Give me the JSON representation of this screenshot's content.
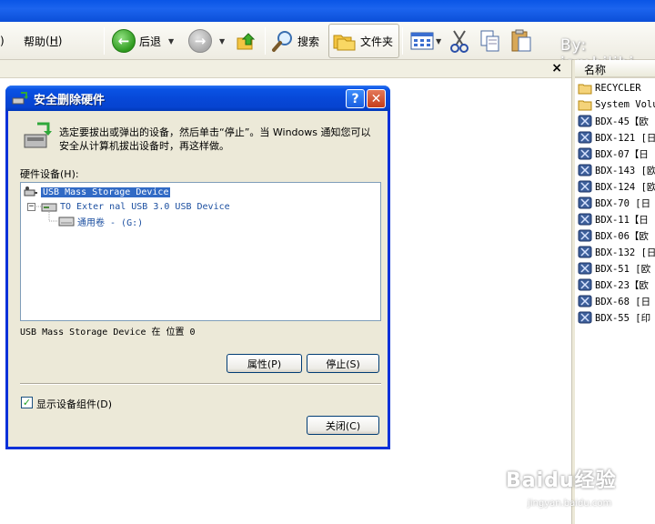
{
  "toolbar": {
    "left_fragment": ")",
    "help_label": "帮助",
    "help_key": "H",
    "back_label": "后退",
    "search_label": "搜索",
    "folders_label": "文件夹",
    "watermark": "By: iambilibi"
  },
  "explorer": {
    "close_glyph": "×",
    "name_column": "名称",
    "files": [
      {
        "name": "RECYCLER",
        "icon": "folder-icon"
      },
      {
        "name": "System Volu",
        "icon": "folder-icon"
      },
      {
        "name": "BDX-45【欧",
        "icon": "media-file-icon"
      },
      {
        "name": "BDX-121 [日",
        "icon": "media-file-icon"
      },
      {
        "name": "BDX-07【日",
        "icon": "media-file-icon"
      },
      {
        "name": "BDX-143 [欧",
        "icon": "media-file-icon"
      },
      {
        "name": "BDX-124 [欧",
        "icon": "media-file-icon"
      },
      {
        "name": "BDX-70 [日",
        "icon": "media-file-icon"
      },
      {
        "name": "BDX-11【日",
        "icon": "media-file-icon"
      },
      {
        "name": "BDX-06【欧",
        "icon": "media-file-icon"
      },
      {
        "name": "BDX-132 [日",
        "icon": "media-file-icon"
      },
      {
        "name": "BDX-51 [欧",
        "icon": "media-file-icon"
      },
      {
        "name": "BDX-23【欧",
        "icon": "media-file-icon"
      },
      {
        "name": "BDX-68 [日",
        "icon": "media-file-icon"
      },
      {
        "name": "BDX-55 [印",
        "icon": "media-file-icon"
      }
    ]
  },
  "dialog": {
    "title": "安全删除硬件",
    "intro": "选定要拔出或弹出的设备，然后单击“停止”。当 Windows 通知您可以安全从计算机拔出设备时，再这样做。",
    "devices_label": "硬件设备(H):",
    "tree": [
      {
        "label": "USB Mass Storage Device",
        "level": 0,
        "selected": true
      },
      {
        "label": "TO Exter nal USB 3.0 USB Device",
        "level": 1,
        "selected": false
      },
      {
        "label": "通用卷 - (G:)",
        "level": 2,
        "selected": false
      }
    ],
    "status": "USB Mass Storage Device 在 位置 0",
    "properties_button": "属性(P)",
    "stop_button": "停止(S)",
    "show_components_label": "显示设备组件(D)",
    "show_components_checked": true,
    "close_button": "关闭(C)"
  },
  "watermark": {
    "logo": "Baidu经验",
    "url": "jingyan.baidu.com"
  }
}
